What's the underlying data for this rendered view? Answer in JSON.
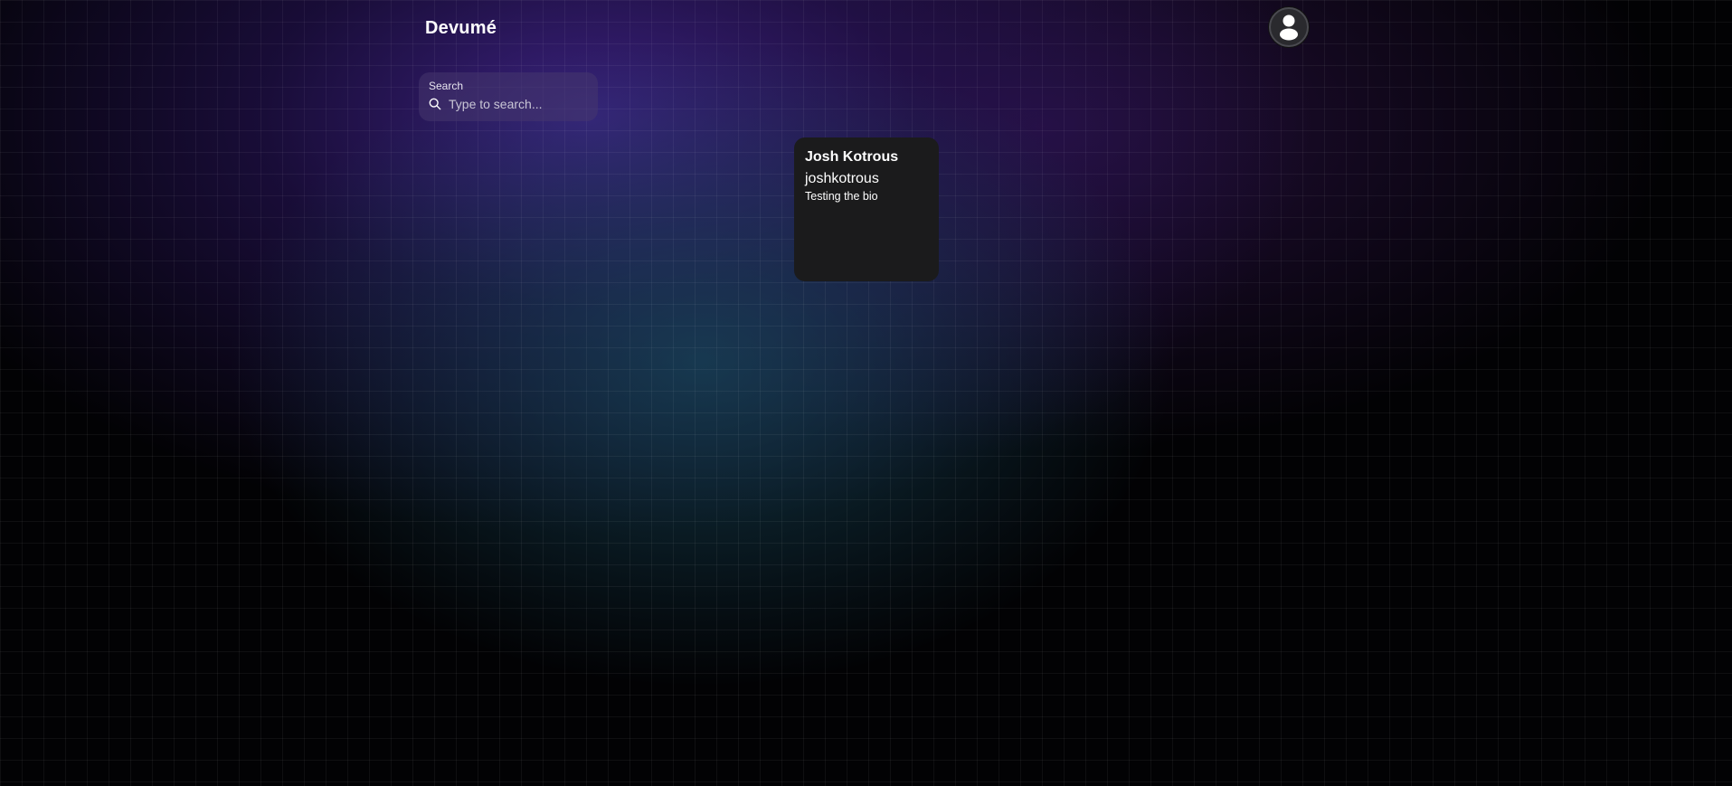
{
  "header": {
    "brand": "Devumé",
    "profile_icon": "user-avatar-icon"
  },
  "search": {
    "label": "Search",
    "placeholder": "Type to search...",
    "value": "",
    "icon": "search-icon"
  },
  "results": [
    {
      "name": "Josh Kotrous",
      "username": "joshkotrous",
      "bio": "Testing the bio"
    }
  ],
  "colors": {
    "background": "#020204",
    "glow_purple": "#3c2282",
    "glow_teal": "#18485c",
    "card": "#1b1b1c",
    "search_bg": "#46376e"
  }
}
